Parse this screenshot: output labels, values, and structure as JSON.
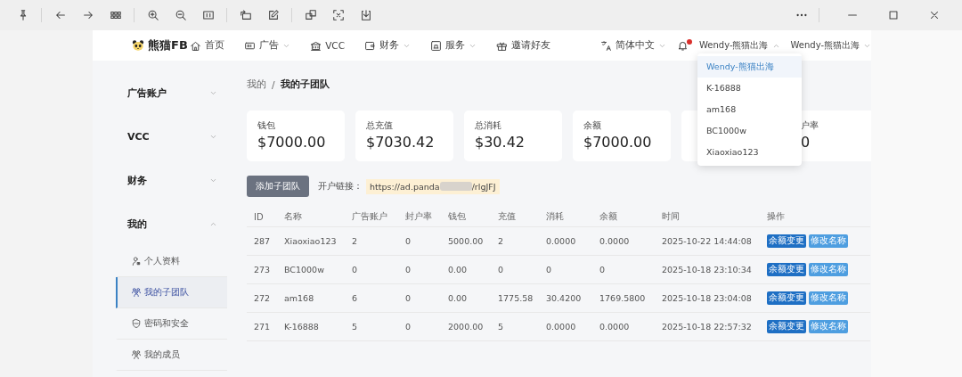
{
  "brand": {
    "name": "熊猫FB"
  },
  "nav": [
    {
      "label": "首页",
      "dropdown": false
    },
    {
      "label": "广告",
      "dropdown": true
    },
    {
      "label": "VCC",
      "dropdown": false
    },
    {
      "label": "财务",
      "dropdown": true
    },
    {
      "label": "服务",
      "dropdown": true
    },
    {
      "label": "邀请好友",
      "dropdown": false
    }
  ],
  "language": {
    "label": "简体中文"
  },
  "notifications": {
    "unread": true
  },
  "account_menus": [
    {
      "label": "Wendy-熊猫出海",
      "open": true
    },
    {
      "label": "Wendy-熊猫出海",
      "open": false
    }
  ],
  "account_dropdown": [
    {
      "label": "Wendy-熊猫出海",
      "selected": true
    },
    {
      "label": "K-16888",
      "selected": false
    },
    {
      "label": "am168",
      "selected": false
    },
    {
      "label": "BC1000w",
      "selected": false
    },
    {
      "label": "Xiaoxiao123",
      "selected": false
    }
  ],
  "sidebar": [
    {
      "label": "广告账户",
      "expanded": false
    },
    {
      "label": "VCC",
      "expanded": false
    },
    {
      "label": "财务",
      "expanded": false
    },
    {
      "label": "我的",
      "expanded": true,
      "children": [
        {
          "label": "个人资料",
          "selected": false
        },
        {
          "label": "我的子团队",
          "selected": true
        },
        {
          "label": "密码和安全",
          "selected": false
        },
        {
          "label": "我的成员",
          "selected": false
        }
      ]
    }
  ],
  "breadcrumb": {
    "items": [
      "我的",
      "我的子团队"
    ],
    "separator": "/"
  },
  "stats": [
    {
      "kind": "stat",
      "label": "钱包",
      "value": "$7000.00"
    },
    {
      "kind": "stat",
      "label": "总充值",
      "value": "$7030.42"
    },
    {
      "kind": "stat",
      "label": "总消耗",
      "value": "$30.42"
    },
    {
      "kind": "stat",
      "label": "余额",
      "value": "$7000.00"
    },
    {
      "kind": "covered"
    },
    {
      "kind": "stat",
      "label": "户率",
      "value": "0"
    }
  ],
  "add_button": "添加子团队",
  "signup_link": {
    "label": "开户链接：",
    "prefix": "https://ad.panda",
    "suffix": "/rlgJFJ"
  },
  "table": {
    "columns": [
      "ID",
      "名称",
      "广告账户",
      "封户率",
      "钱包",
      "充值",
      "消耗",
      "余额",
      "时间",
      "操作"
    ],
    "rows": [
      {
        "cells": [
          "287",
          "Xiaoxiao123",
          "2",
          "0",
          "5000.00",
          "2",
          "0.0000",
          "0.0000",
          "2025-10-22 14:44:08"
        ],
        "actions": [
          "余额变更",
          "修改名称"
        ]
      },
      {
        "cells": [
          "273",
          "BC1000w",
          "0",
          "0",
          "0.00",
          "0",
          "0",
          "0",
          "2025-10-18 23:10:34"
        ],
        "actions": [
          "余额变更",
          "修改名称"
        ]
      },
      {
        "cells": [
          "272",
          "am168",
          "6",
          "0",
          "0.00",
          "1775.58",
          "30.4200",
          "1769.5800",
          "2025-10-18 23:04:08"
        ],
        "actions": [
          "余额变更",
          "修改名称"
        ]
      },
      {
        "cells": [
          "271",
          "K-16888",
          "5",
          "0",
          "2000.00",
          "5",
          "0.0000",
          "0.0000",
          "2025-10-18 22:57:32"
        ],
        "actions": [
          "余额变更",
          "修改名称"
        ]
      }
    ]
  }
}
